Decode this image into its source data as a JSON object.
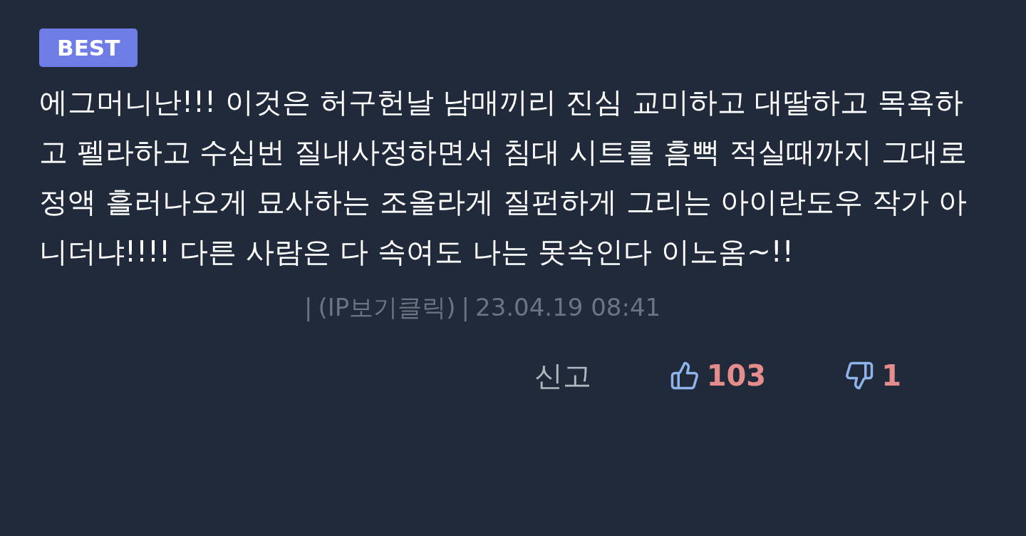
{
  "badge": "BEST",
  "comment": "에그머니난!!! 이것은 허구헌날 남매끼리 진심 교미하고 대딸하고 목욕하고 펠라하고 수십번 질내사정하면서 침대 시트를 흠뻑 적실때까지 그대로 정액 흘러나오게 묘사하는 조올라게 질펀하게 그리는 아이란도우 작가 아니더냐!!!! 다른 사람은 다 속여도 나는 못속인다 이노옴~!!",
  "meta": {
    "separator": "|",
    "ip_link": "(IP보기클릭)",
    "date": "23.04.19 08:41"
  },
  "actions": {
    "report": "신고",
    "likes": "103",
    "dislikes": "1"
  }
}
